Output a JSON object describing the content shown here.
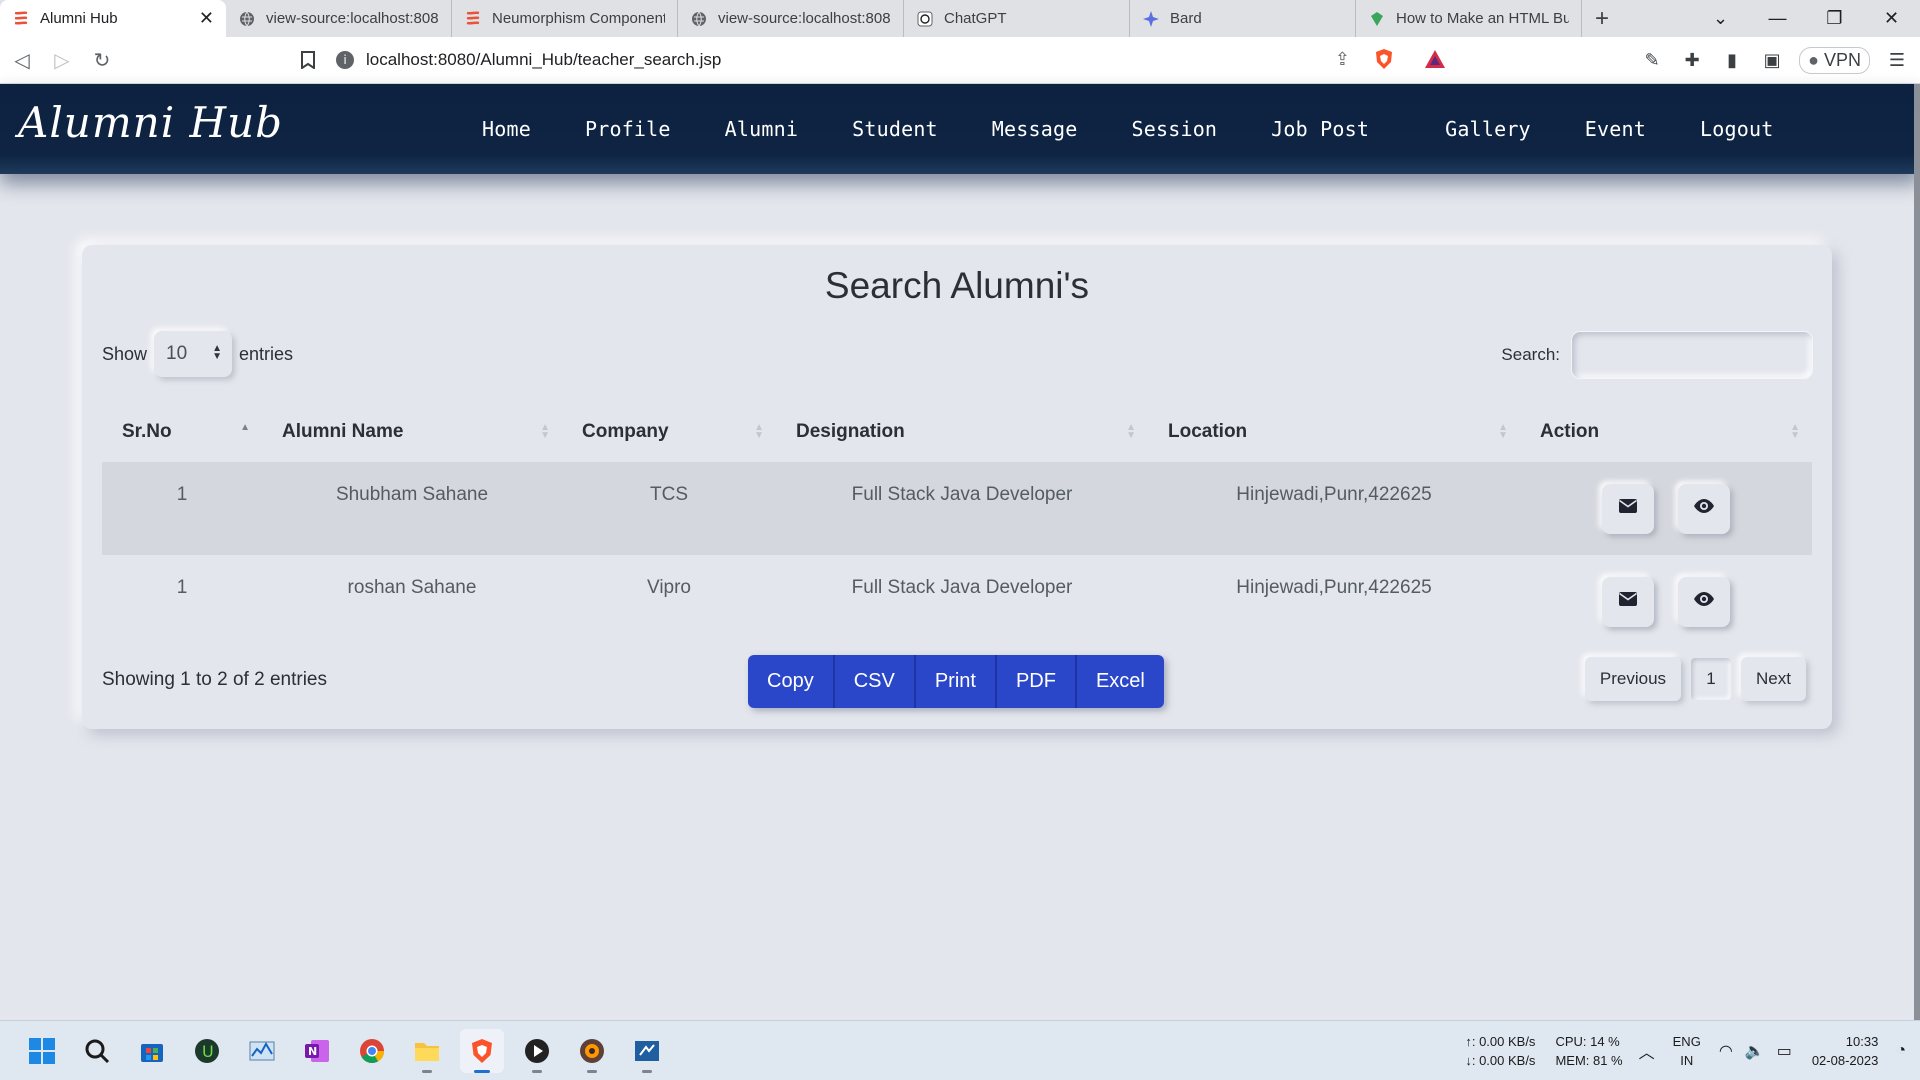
{
  "browser": {
    "tabs": [
      {
        "title": "Alumni Hub",
        "active": true,
        "icon": "neumorphism-icon"
      },
      {
        "title": "view-source:localhost:8080",
        "active": false,
        "icon": "globe-icon"
      },
      {
        "title": "Neumorphism Component",
        "active": false,
        "icon": "neumorphism-icon"
      },
      {
        "title": "view-source:localhost:8080",
        "active": false,
        "icon": "globe-icon"
      },
      {
        "title": "ChatGPT",
        "active": false,
        "icon": "chatgpt-icon"
      },
      {
        "title": "Bard",
        "active": false,
        "icon": "bard-icon"
      },
      {
        "title": "How to Make an HTML But",
        "active": false,
        "icon": "html-icon"
      }
    ],
    "tab_close": "✕",
    "new_tab": "+",
    "url": "localhost:8080/Alumni_Hub/teacher_search.jsp",
    "vpn_label": "VPN"
  },
  "site": {
    "brand": "Alumni Hub",
    "nav": [
      "Home",
      "Profile",
      "Alumni",
      "Student",
      "Message",
      "Session",
      "Job Post",
      "Gallery",
      "Event",
      "Logout"
    ]
  },
  "page": {
    "title": "Search Alumni's",
    "show_label": "Show",
    "entries_value": "10",
    "entries_label": "entries",
    "search_label": "Search:",
    "search_value": "",
    "columns": [
      "Sr.No",
      "Alumni Name",
      "Company",
      "Designation",
      "Location",
      "Action"
    ],
    "rows": [
      {
        "sr": "1",
        "name": "Shubham Sahane",
        "company": "TCS",
        "designation": "Full Stack Java Developer",
        "location": "Hinjewadi,Punr,422625"
      },
      {
        "sr": "1",
        "name": "roshan Sahane",
        "company": "Vipro",
        "designation": "Full Stack Java Developer",
        "location": "Hinjewadi,Punr,422625"
      }
    ],
    "info": "Showing 1 to 2 of 2 entries",
    "export_buttons": [
      "Copy",
      "CSV",
      "Print",
      "PDF",
      "Excel"
    ],
    "pagination": {
      "previous": "Previous",
      "page": "1",
      "next": "Next"
    }
  },
  "taskbar": {
    "apps": [
      "windows-start-icon",
      "search-icon",
      "store-icon",
      "upwork-icon",
      "task-manager-icon",
      "onenote-icon",
      "chrome-icon",
      "file-explorer-icon",
      "brave-icon",
      "media-player-icon",
      "game-icon",
      "remote-desktop-icon"
    ],
    "net_up": "↑: 0.00 KB/s",
    "net_down": "↓: 0.00 KB/s",
    "cpu": "CPU: 14 %",
    "mem": "MEM: 81 %",
    "lang_top": "ENG",
    "lang_bottom": "IN",
    "time": "10:33",
    "date": "02-08-2023"
  },
  "colors": {
    "navbar": "#0e2442",
    "page_bg": "#e4e6ed",
    "export_button": "#2b47c9",
    "row_stripe": "#d5d7de"
  }
}
